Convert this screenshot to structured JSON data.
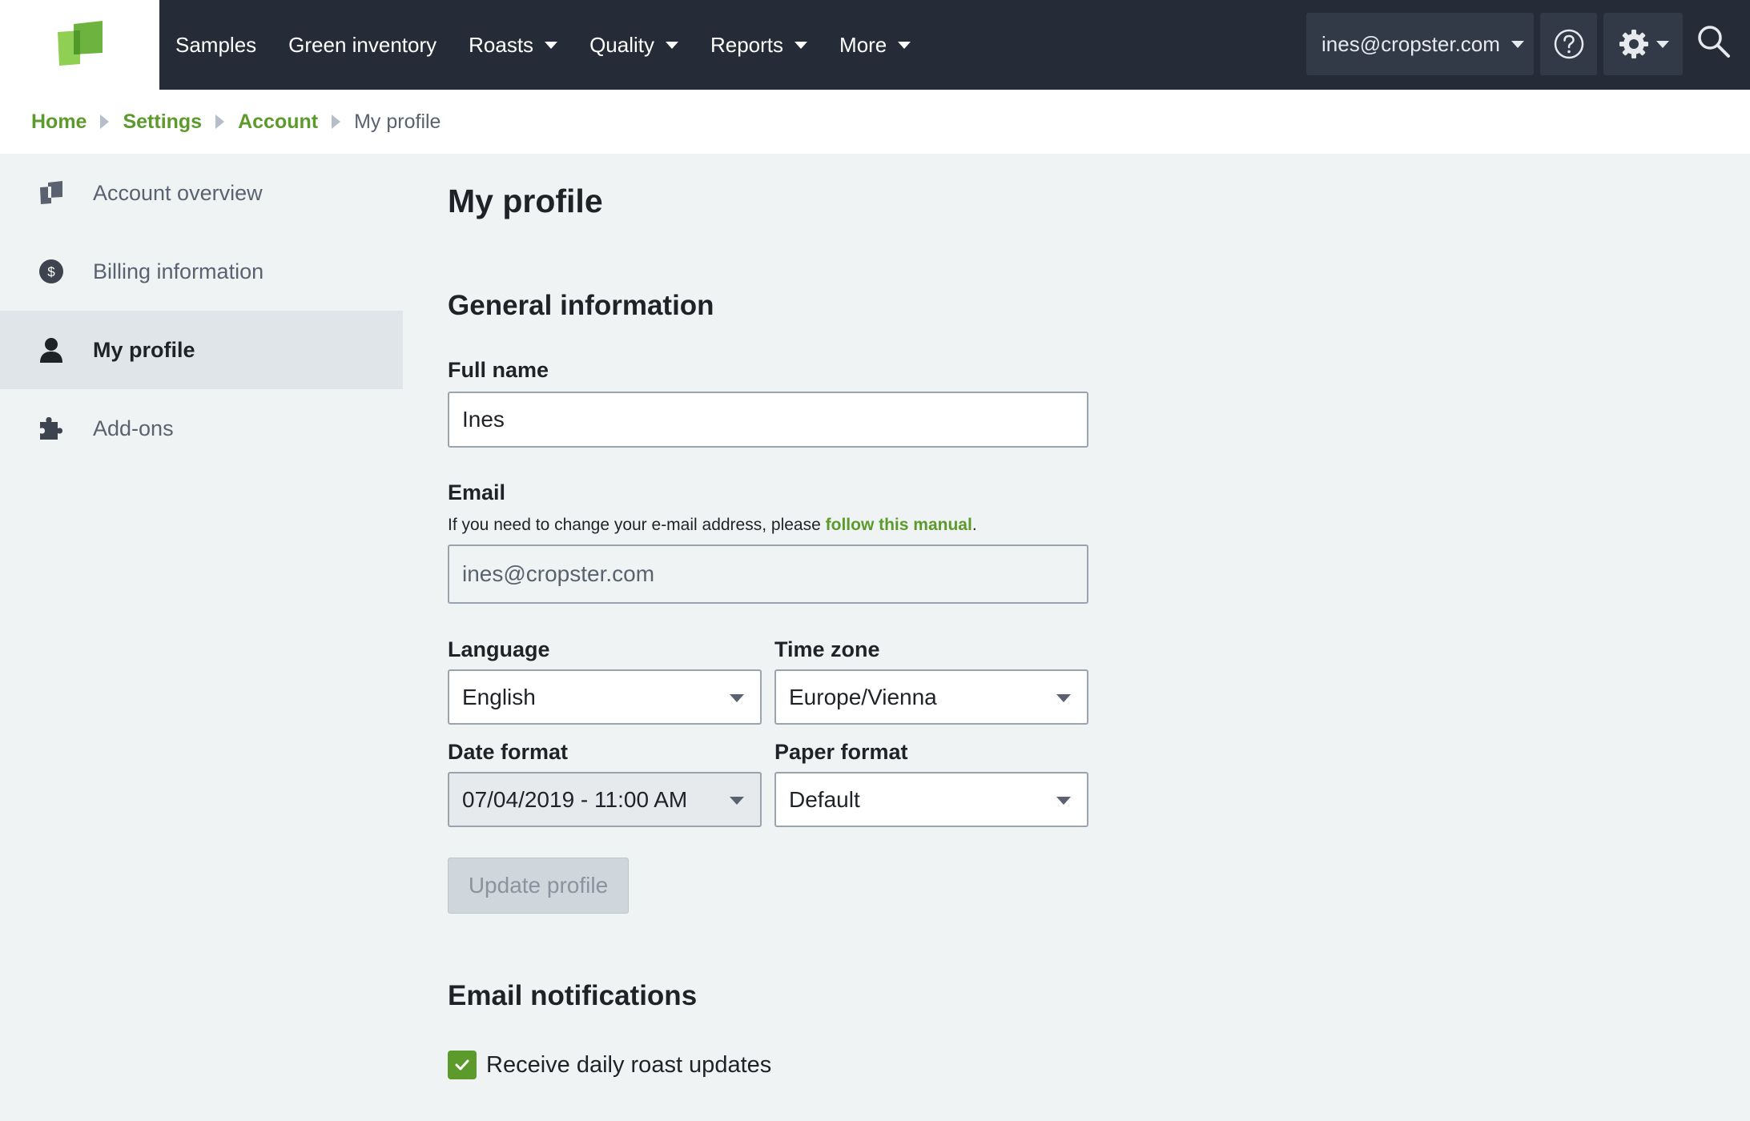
{
  "nav": {
    "items": [
      {
        "label": "Samples",
        "dropdown": false
      },
      {
        "label": "Green inventory",
        "dropdown": false
      },
      {
        "label": "Roasts",
        "dropdown": true
      },
      {
        "label": "Quality",
        "dropdown": true
      },
      {
        "label": "Reports",
        "dropdown": true
      },
      {
        "label": "More",
        "dropdown": true
      }
    ],
    "user_email": "ines@cropster.com",
    "help_icon": "help-circle-icon",
    "settings_icon": "gear-icon",
    "search_icon": "search-icon",
    "logo_color": "#6db33f"
  },
  "breadcrumb": {
    "home": "Home",
    "settings": "Settings",
    "account": "Account",
    "current": "My profile"
  },
  "sidebar": {
    "items": [
      {
        "label": "Account overview",
        "icon": "account-overview-icon"
      },
      {
        "label": "Billing information",
        "icon": "dollar-icon"
      },
      {
        "label": "My profile",
        "icon": "user-icon",
        "active": true
      },
      {
        "label": "Add-ons",
        "icon": "puzzle-icon"
      }
    ]
  },
  "main": {
    "title": "My profile",
    "general_title": "General information",
    "full_name_label": "Full name",
    "full_name_value": "Ines",
    "email_label": "Email",
    "email_hint_prefix": "If you need to change your e-mail address, please ",
    "email_hint_link": "follow this manual",
    "email_hint_suffix": ".",
    "email_value": "ines@cropster.com",
    "language_label": "Language",
    "language_value": "English",
    "timezone_label": "Time zone",
    "timezone_value": "Europe/Vienna",
    "date_format_label": "Date format",
    "date_format_value": "07/04/2019 - 11:00 AM",
    "paper_format_label": "Paper format",
    "paper_format_value": "Default",
    "update_button": "Update profile",
    "notifications_title": "Email notifications",
    "daily_updates_label": "Receive daily roast updates",
    "daily_updates_checked": true
  },
  "colors": {
    "accent": "#5c9a2c",
    "topbar": "#262c37"
  }
}
